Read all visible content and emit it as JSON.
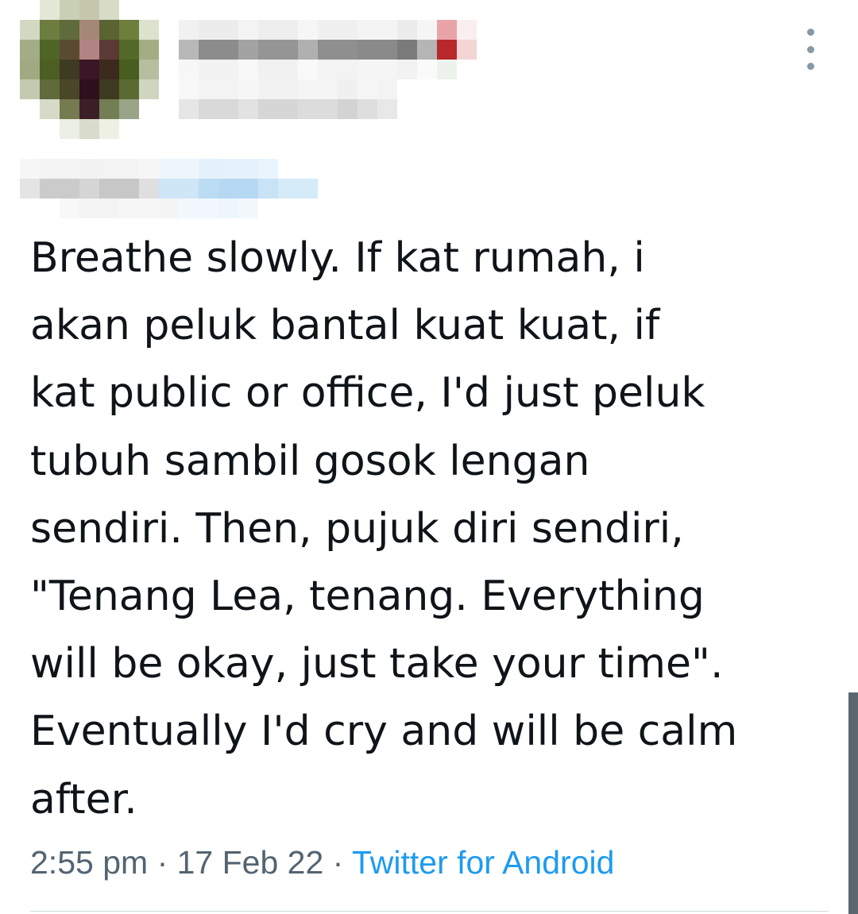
{
  "tweet": {
    "text_lines": [
      "Breathe slowly. If kat rumah, i",
      "akan peluk bantal kuat kuat, if",
      "kat public or office, I'd just peluk",
      "tubuh sambil gosok lengan",
      "sendiri. Then, pujuk diri sendiri,",
      "\"Tenang Lea, tenang. Everything",
      "will be okay, just take your time\".",
      "Eventually I'd cry and will be calm",
      "after."
    ],
    "time": "2:55 pm",
    "date": "17 Feb 22",
    "separator": "·",
    "source": "Twitter for Android"
  },
  "author": {
    "avatar_icon": "pixelated-avatar",
    "name_obscured": true,
    "handle_obscured": true
  },
  "icons": {
    "more": "more-vertical-icon"
  },
  "colors": {
    "text": "#0f1419",
    "meta": "#536471",
    "link": "#1d9bf0",
    "divider": "#cfd9de"
  }
}
